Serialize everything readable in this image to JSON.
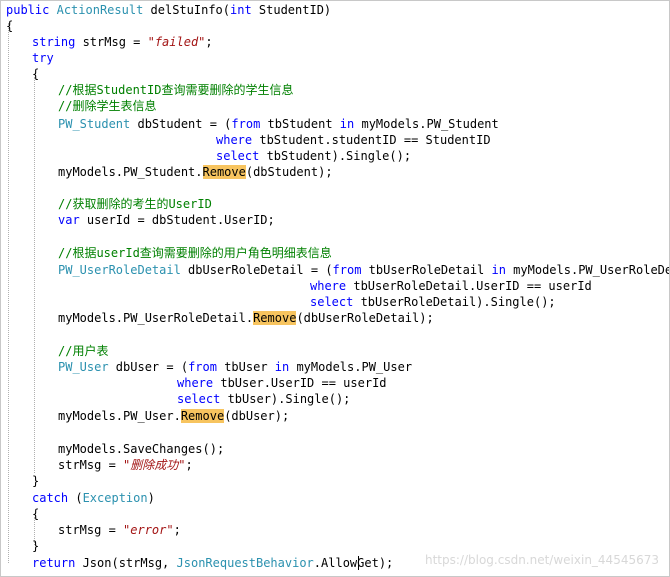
{
  "code": {
    "line_1": {
      "kw1": "public",
      "ty1": "ActionResult",
      "rest": " delStuInfo(",
      "kw2": "int",
      "rest2": " StudentID)"
    },
    "line_2": {
      "text": "{"
    },
    "line_3": {
      "kw": "string",
      "mid": " strMsg = ",
      "str": "\"failed\"",
      "end": ";"
    },
    "line_4": {
      "kw": "try"
    },
    "line_5": {
      "text": "{"
    },
    "line_6": {
      "comment": "//根据StudentID查询需要删除的学生信息"
    },
    "line_7": {
      "comment": "//删除学生表信息"
    },
    "line_8": {
      "ty": "PW_Student",
      "mid": " dbStudent = (",
      "kw1": "from",
      "mid2": " tbStudent ",
      "kw2": "in",
      "end": " myModels.PW_Student"
    },
    "line_9": {
      "kw": "where",
      "rest": " tbStudent.studentID == StudentID"
    },
    "line_10": {
      "kw": "select",
      "rest": " tbStudent).Single();"
    },
    "line_11": {
      "pre": "myModels.PW_Student.",
      "hl": "Remove",
      "post": "(dbStudent);"
    },
    "line_13": {
      "comment": "//获取删除的考生的UserID"
    },
    "line_14": {
      "kw": "var",
      "rest": " userId = dbStudent.UserID;"
    },
    "line_16": {
      "comment": "//根据userId查询需要删除的用户角色明细表信息"
    },
    "line_17": {
      "ty": "PW_UserRoleDetail",
      "mid": " dbUserRoleDetail = (",
      "kw1": "from",
      "mid2": " tbUserRoleDetail ",
      "kw2": "in",
      "end": " myModels.PW_UserRoleDetail"
    },
    "line_18": {
      "kw": "where",
      "rest": " tbUserRoleDetail.UserID == userId"
    },
    "line_19": {
      "kw": "select",
      "rest": " tbUserRoleDetail).Single();"
    },
    "line_20": {
      "pre": "myModels.PW_UserRoleDetail.",
      "hl": "Remove",
      "post": "(dbUserRoleDetail);"
    },
    "line_22": {
      "comment": "//用户表"
    },
    "line_23": {
      "ty": "PW_User",
      "mid": " dbUser = (",
      "kw1": "from",
      "mid2": " tbUser ",
      "kw2": "in",
      "end": " myModels.PW_User"
    },
    "line_24": {
      "kw": "where",
      "rest": " tbUser.UserID == userId"
    },
    "line_25": {
      "kw": "select",
      "rest": " tbUser).Single();"
    },
    "line_26": {
      "pre": "myModels.PW_User.",
      "hl": "Remove",
      "post": "(dbUser);"
    },
    "line_28": {
      "text": "myModels.SaveChanges();"
    },
    "line_29": {
      "pre": "strMsg = ",
      "str": "\"删除成功\"",
      "end": ";"
    },
    "line_30": {
      "text": "}"
    },
    "line_31": {
      "kw": "catch",
      "mid": " (",
      "ty": "Exception",
      "end": ")"
    },
    "line_32": {
      "text": "{"
    },
    "line_33": {
      "pre": "strMsg = ",
      "str": "\"error\"",
      "end": ";"
    },
    "line_34": {
      "text": "}"
    },
    "line_35": {
      "kw": "return",
      "mid": " Json(strMsg, ",
      "ty": "JsonRequestBehavior",
      "end": ".AllowGet);"
    }
  },
  "watermark": "https://blog.csdn.net/weixin_44545673"
}
